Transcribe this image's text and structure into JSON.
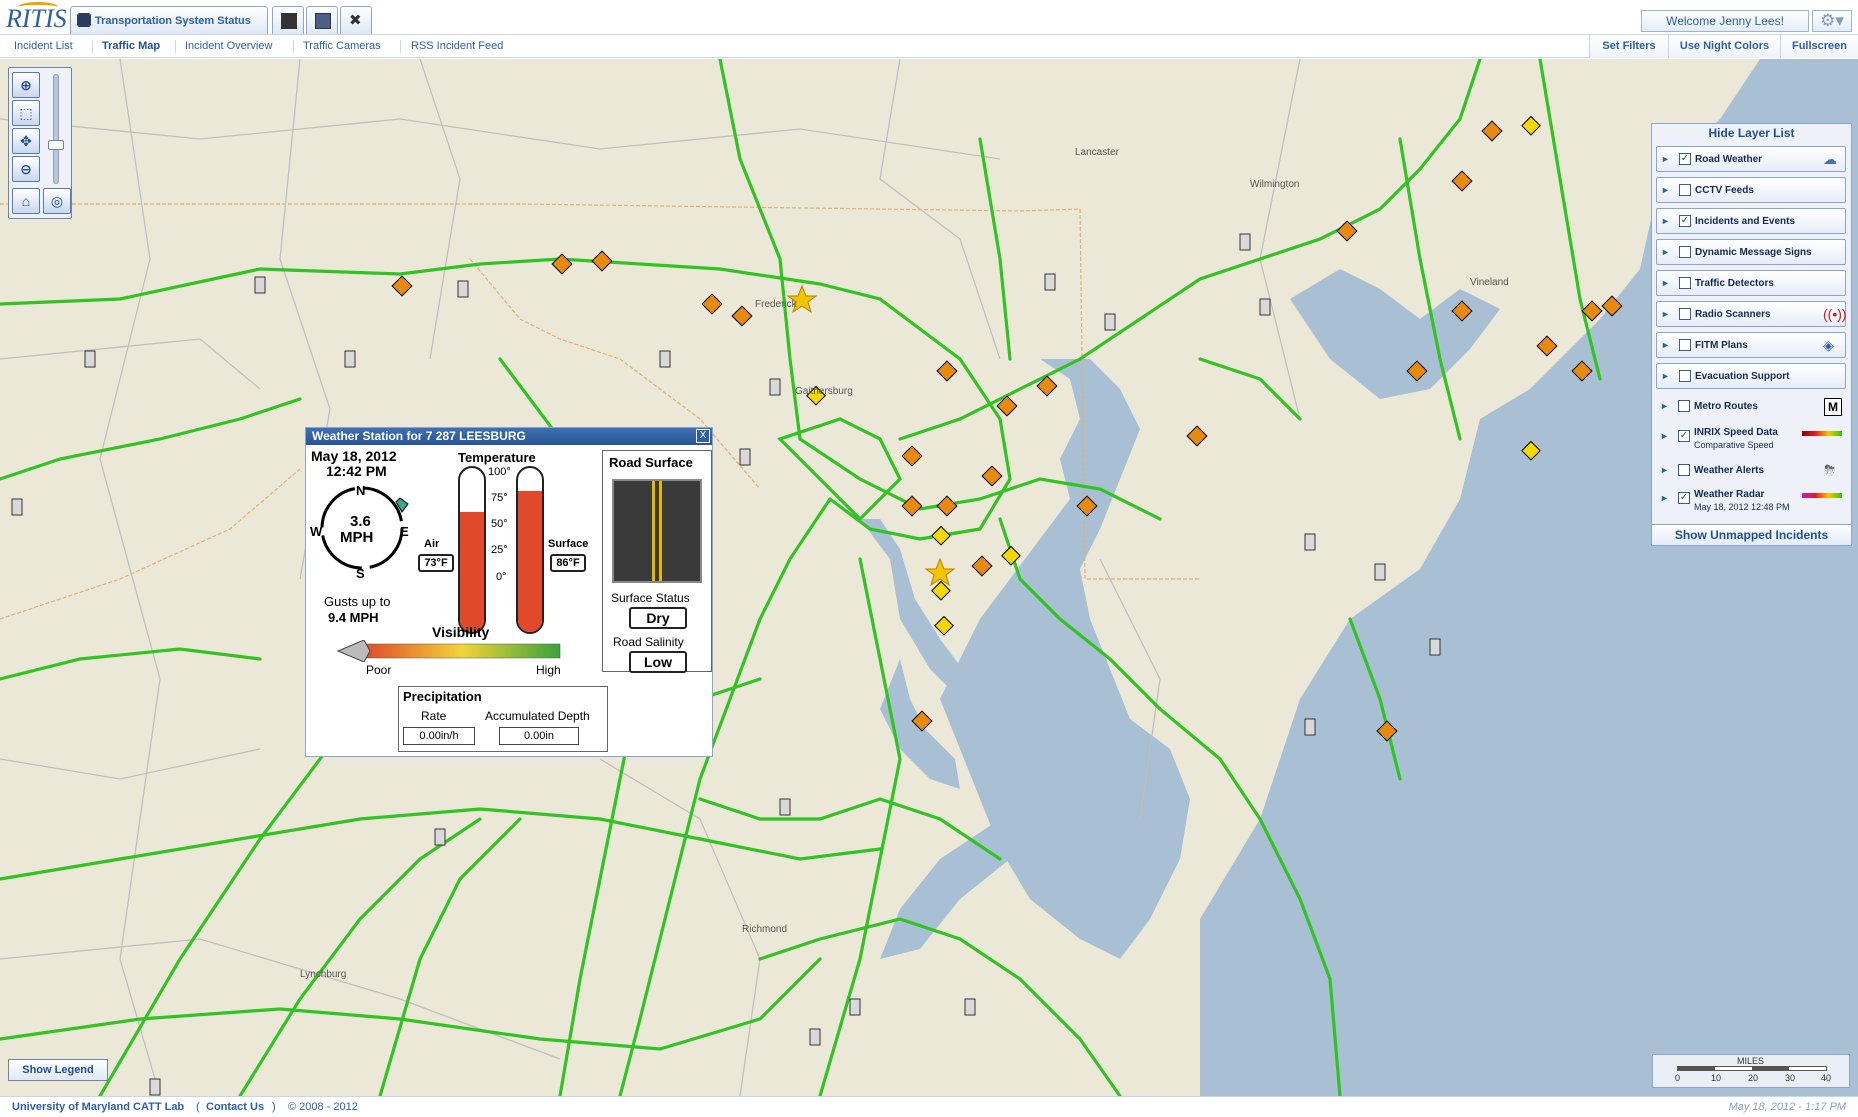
{
  "app": {
    "logo_text": "RITIS",
    "main_tab": "Transportation System Status"
  },
  "header": {
    "welcome": "Welcome Jenny Lees!"
  },
  "nav": {
    "links": [
      "Incident List",
      "Traffic Map",
      "Incident Overview",
      "Traffic Cameras",
      "RSS Incident Feed"
    ],
    "active": "Traffic Map",
    "right_buttons": [
      "Set Filters",
      "Use Night Colors",
      "Fullscreen"
    ]
  },
  "weather_popup": {
    "title": "Weather Station for 7 287 LEESBURG",
    "date": "May 18, 2012",
    "time": "12:42 PM",
    "wind_speed": "3.6",
    "wind_unit": "MPH",
    "compass": {
      "n": "N",
      "s": "S",
      "e": "E",
      "w": "W"
    },
    "gusts_label": "Gusts up to",
    "gusts_value": "9.4 MPH",
    "temperature_label": "Temperature",
    "temp_scale": [
      "100°",
      "75°",
      "50°",
      "25°",
      "0°"
    ],
    "air_label": "Air",
    "air_value": "73°F",
    "air_fraction": 0.73,
    "surface_label": "Surface",
    "surface_value": "86°F",
    "surface_fraction": 0.86,
    "visibility_label": "Visibility",
    "visibility_low": "Poor",
    "visibility_high": "High",
    "road_surface_label": "Road Surface",
    "surface_status_label": "Surface Status",
    "surface_status_value": "Dry",
    "road_salinity_label": "Road Salinity",
    "road_salinity_value": "Low",
    "precip_label": "Precipitation",
    "rate_label": "Rate",
    "rate_value": "0.00in/h",
    "depth_label": "Accumulated Depth",
    "depth_value": "0.00in"
  },
  "layers": {
    "header": "Hide Layer List",
    "items": [
      {
        "name": "Road Weather",
        "checked": true,
        "icon": "cloud-icon"
      },
      {
        "name": "CCTV Feeds",
        "checked": false
      },
      {
        "name": "Incidents and Events",
        "checked": true
      },
      {
        "name": "Dynamic Message Signs",
        "checked": false
      },
      {
        "name": "Traffic Detectors",
        "checked": false
      },
      {
        "name": "Radio Scanners",
        "checked": false,
        "icon": "radio-icon"
      },
      {
        "name": "FITM Plans",
        "checked": false,
        "icon": "diamond-icon"
      },
      {
        "name": "Evacuation Support",
        "checked": false
      },
      {
        "name": "Metro Routes",
        "checked": false,
        "icon": "metro-icon"
      },
      {
        "name": "INRIX Speed Data",
        "checked": true,
        "sub": "Comparative Speed"
      },
      {
        "name": "Weather Alerts",
        "checked": false,
        "icon": "storm-icon"
      },
      {
        "name": "Weather Radar",
        "checked": true,
        "sub": "May 18, 2012 12:48 PM"
      }
    ],
    "unmapped_button": "Show Unmapped Incidents"
  },
  "map_labels": [
    "Lancaster",
    "Frederick",
    "Gaithersburg",
    "Vineland",
    "Richmond",
    "Lynchburg",
    "Wilmington"
  ],
  "legend_button": "Show Legend",
  "scale": {
    "title": "MILES",
    "ticks": [
      "0",
      "10",
      "20",
      "30",
      "40"
    ]
  },
  "footer": {
    "org": "University of Maryland CATT Lab",
    "contact": "Contact Us",
    "copyright": "© 2008 - 2012",
    "timestamp": "May 18, 2012 - 1:17 PM"
  },
  "colors": {
    "road_green": "#31c321",
    "water": "#a8bfd4",
    "land": "#ece8d8",
    "accent": "#2b5fa8"
  }
}
